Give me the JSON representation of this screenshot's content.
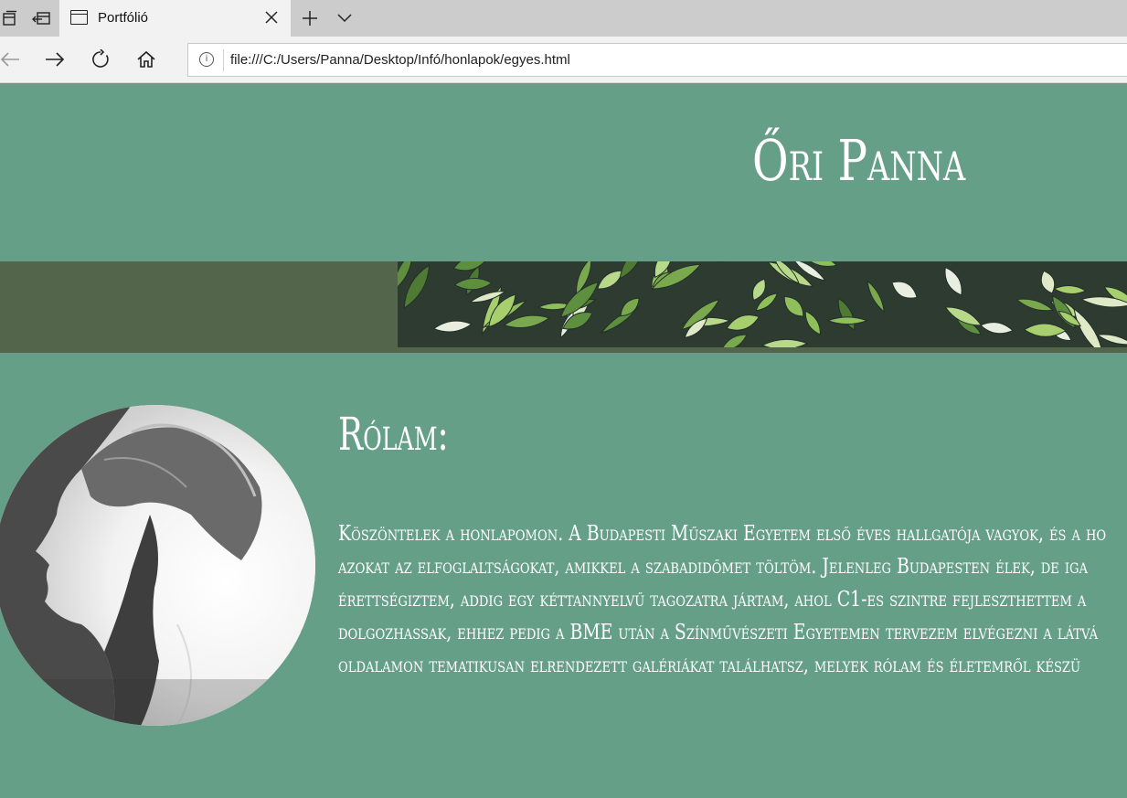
{
  "browser": {
    "tab": {
      "title": "Portfólió"
    },
    "address": {
      "url": "file:///C:/Users/Panna/Desktop/Infó/honlapok/egyes.html"
    },
    "icons": [
      "tab-list-icon",
      "set-aside-tabs-icon",
      "tab-page-icon",
      "close-icon",
      "new-tab-icon",
      "chevron-down-icon",
      "back-arrow-icon",
      "forward-arrow-icon",
      "refresh-icon",
      "home-icon",
      "info-icon"
    ]
  },
  "page": {
    "site_title": "Őri Panna",
    "about_heading": "Rólam:",
    "about_lines": [
      "Köszöntelek a honlapomon. A Budapesti Műszaki Egyetem első éves hallgatója vagyok, és a ho",
      "azokat az elfoglaltságokat, amikkel a szabadidőmet töltöm. Jelenleg Budapesten élek, de iga",
      "érettségiztem, addig egy kéttannyelvű tagozatra jártam, ahol C1-es szintre fejleszthettem a",
      "dolgozhassak, ehhez pedig a BME után a Színművészeti Egyetemen tervezem elvégezni a látvá",
      "oldalamon tematikusan elrendezett galériákat találhatsz, melyek rólam és életemről készü"
    ],
    "colors": {
      "background": "#669f87",
      "band": "#53654a",
      "text": "#ffffff"
    }
  }
}
